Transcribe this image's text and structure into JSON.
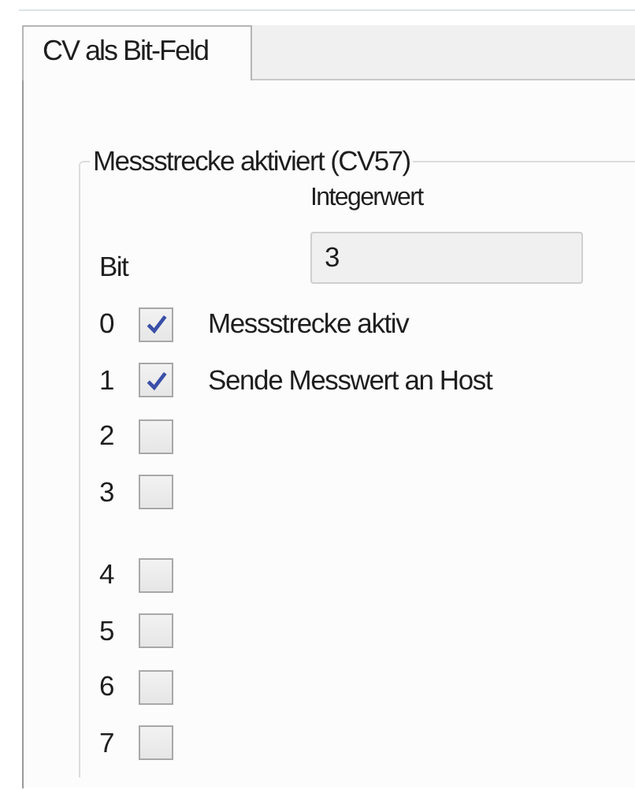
{
  "tabs": [
    {
      "label": "CV als Bit-Feld",
      "selected": true
    }
  ],
  "group": {
    "title": "Messstrecke aktiviert (CV57)",
    "integer_label": "Integerwert",
    "integer_value": "3",
    "bit_header": "Bit",
    "bits": [
      {
        "index": "0",
        "checked": true,
        "label": "Messstrecke aktiv"
      },
      {
        "index": "1",
        "checked": true,
        "label": "Sende Messwert an Host"
      },
      {
        "index": "2",
        "checked": false
      },
      {
        "index": "3",
        "checked": false
      },
      {
        "index": "4",
        "checked": false
      },
      {
        "index": "5",
        "checked": false
      },
      {
        "index": "6",
        "checked": false
      },
      {
        "index": "7",
        "checked": false
      }
    ]
  }
}
